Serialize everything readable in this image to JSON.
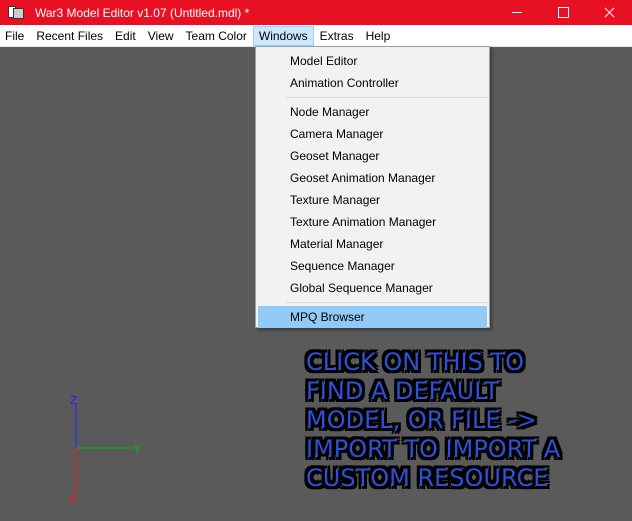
{
  "window": {
    "title": "War3 Model Editor v1.07 (Untitled.mdl) *"
  },
  "menubar": {
    "items": [
      "File",
      "Recent Files",
      "Edit",
      "View",
      "Team Color",
      "Windows",
      "Extras",
      "Help"
    ],
    "active": "Windows"
  },
  "windows_menu": {
    "groups": [
      [
        "Model Editor",
        "Animation Controller"
      ],
      [
        "Node Manager",
        "Camera Manager",
        "Geoset Manager",
        "Geoset Animation Manager",
        "Texture Manager",
        "Texture Animation Manager",
        "Material Manager",
        "Sequence Manager",
        "Global Sequence Manager"
      ],
      [
        "MPQ Browser"
      ]
    ],
    "highlighted": "MPQ Browser"
  },
  "annotation": {
    "lines": [
      "CLICK ON THIS TO",
      "FIND A DEFAULT",
      "MODEL, OR FILE ->",
      "IMPORT TO IMPORT A",
      "CUSTOM RESOURCE"
    ]
  },
  "axes": {
    "labels": {
      "z": "Z",
      "y": "Y",
      "x": "X"
    },
    "colors": {
      "z": "#2020ff",
      "y": "#00c000",
      "x": "#ff1a1a"
    }
  },
  "colors": {
    "titlebar": "#e81123",
    "viewport": "#5a5a5a",
    "menu_highlight": "#91c9f7",
    "annotation_text": "#2f50d4"
  }
}
